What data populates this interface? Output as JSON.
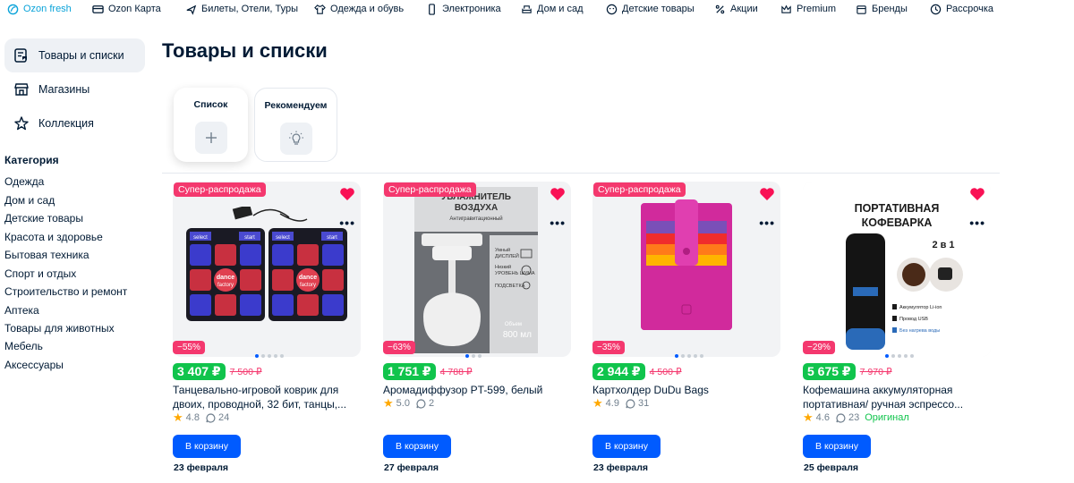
{
  "nav": [
    {
      "label": "Ozon fresh",
      "icon": "leaf-icon"
    },
    {
      "label": "Ozon Карта",
      "icon": "card-icon"
    },
    {
      "label": "Билеты, Отели, Туры",
      "icon": "plane-icon"
    },
    {
      "label": "Одежда и обувь",
      "icon": "clothes-icon"
    },
    {
      "label": "Электроника",
      "icon": "phone-icon"
    },
    {
      "label": "Дом и сад",
      "icon": "sofa-icon"
    },
    {
      "label": "Детские товары",
      "icon": "kids-icon"
    },
    {
      "label": "Акции",
      "icon": "percent-icon"
    },
    {
      "label": "Premium",
      "icon": "crown-icon"
    },
    {
      "label": "Бренды",
      "icon": "brand-icon"
    },
    {
      "label": "Рассрочка",
      "icon": "installment-icon"
    }
  ],
  "sidebar": {
    "links": [
      {
        "label": "Товары и списки",
        "icon": "list-icon",
        "active": true
      },
      {
        "label": "Магазины",
        "icon": "store-icon",
        "active": false
      },
      {
        "label": "Коллекция",
        "icon": "star-icon",
        "active": false
      }
    ],
    "category_title": "Категория",
    "categories": [
      "Одежда",
      "Дом и сад",
      "Детские товары",
      "Красота и здоровье",
      "Бытовая техника",
      "Спорт и отдых",
      "Строительство и ремонт",
      "Аптека",
      "Товары для животных",
      "Мебель",
      "Аксессуары"
    ]
  },
  "main": {
    "title": "Товары и списки",
    "tiles": [
      {
        "label": "Список",
        "icon": "plus-icon"
      },
      {
        "label": "Рекомендуем",
        "icon": "bulb-icon"
      }
    ]
  },
  "products": [
    {
      "promo": "Супер-распродажа",
      "discount": "−55%",
      "price": "3 407 ₽",
      "old_price": "7 500 ₽",
      "title": "Танцевально-игровой коврик для двоих, проводной, 32 бит, танцы,...",
      "rating": "4.8",
      "reviews": "24",
      "original": "",
      "button": "В корзину",
      "date": "23 февраля",
      "image_text": [
        "select",
        "start",
        "select",
        "start",
        "dance",
        "factory",
        "dance",
        "factory"
      ]
    },
    {
      "promo": "Супер-распродажа",
      "discount": "−63%",
      "price": "1 751 ₽",
      "old_price": "4 788 ₽",
      "title": "Аромадиффузор PT-599, белый",
      "rating": "5.0",
      "reviews": "2",
      "original": "",
      "button": "В корзину",
      "date": "27 февраля",
      "image_text": [
        "УВЛАЖНИТЕЛЬ",
        "ВОЗДУХА",
        "Антигравитационный",
        "Умный",
        "ДИСПЛЕЙ",
        "Низкий",
        "УРОВЕНЬ ШУМА",
        "ПОДСВЕТКА",
        "Объем",
        "800 мл"
      ]
    },
    {
      "promo": "Супер-распродажа",
      "discount": "−35%",
      "price": "2 944 ₽",
      "old_price": "4 500 ₽",
      "title": "Картхолдер DuDu Bags",
      "rating": "4.9",
      "reviews": "31",
      "original": "",
      "button": "В корзину",
      "date": "23 февраля",
      "image_text": []
    },
    {
      "promo": "",
      "discount": "−29%",
      "price": "5 675 ₽",
      "old_price": "7 970 ₽",
      "title": "Кофемашина аккумуляторная портативная/ ручная эспрессо...",
      "rating": "4.6",
      "reviews": "23",
      "original": "Оригинал",
      "button": "В корзину",
      "date": "25 февраля",
      "image_text": [
        "ПОРТАТИВНАЯ",
        "КОФЕВАРКА",
        "2 в 1",
        "Аккумулятор Li-ion",
        "Провод USB",
        "Без нагрева воды"
      ]
    }
  ],
  "colors": {
    "accent": "#005bff",
    "price": "#10c44c",
    "sale": "#f4386e",
    "heart": "#f91155",
    "star": "#ffa800"
  }
}
